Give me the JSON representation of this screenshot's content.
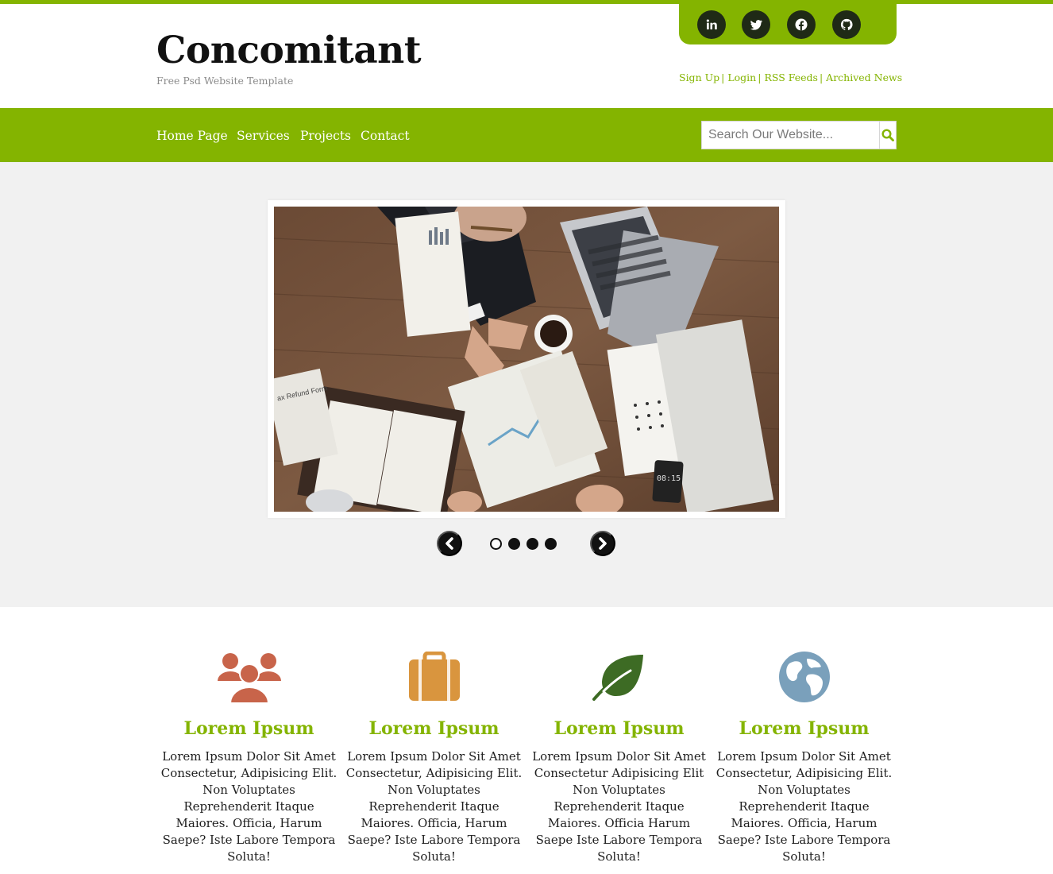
{
  "brand": {
    "logo": "Concomitant",
    "tagline": "Free Psd Website Template",
    "accent_color": "#84b400"
  },
  "social": [
    {
      "icon": "linkedin-icon"
    },
    {
      "icon": "twitter-icon"
    },
    {
      "icon": "facebook-icon"
    },
    {
      "icon": "github-icon"
    }
  ],
  "top_links": {
    "sign_up": "Sign Up",
    "login": "Login",
    "rss": "RSS Feeds",
    "archived": "Archived News",
    "separator": "|"
  },
  "nav": {
    "items": [
      "Home Page",
      "Services",
      "Projects",
      "Contact"
    ]
  },
  "search": {
    "placeholder": "Search Our Website...",
    "icon": "search-icon"
  },
  "slider": {
    "prev_icon": "chevron-left-icon",
    "next_icon": "chevron-right-icon",
    "active_index": 0,
    "dot_count": 4
  },
  "features": [
    {
      "icon": "users-icon",
      "icon_color": "#c8644a",
      "title": "Lorem Ipsum",
      "text": "Lorem Ipsum Dolor Sit Amet Consectetur, Adipisicing Elit. Non Voluptates Reprehenderit Itaque Maiores. Officia, Harum Saepe? Iste Labore Tempora Soluta!"
    },
    {
      "icon": "briefcase-icon",
      "icon_color": "#d9953e",
      "title": "Lorem Ipsum",
      "text": "Lorem Ipsum Dolor Sit Amet Consectetur, Adipisicing Elit. Non Voluptates Reprehenderit Itaque Maiores. Officia, Harum Saepe? Iste Labore Tempora Soluta!"
    },
    {
      "icon": "leaf-icon",
      "icon_color": "#3d6b24",
      "title": "Lorem Ipsum",
      "text": "Lorem Ipsum Dolor Sit Amet Consectetur Adipisicing Elit Non Voluptates Reprehenderit Itaque Maiores. Officia Harum Saepe Iste Labore Tempora Soluta!"
    },
    {
      "icon": "globe-icon",
      "icon_color": "#7aa0bb",
      "title": "Lorem Ipsum",
      "text": "Lorem Ipsum Dolor Sit Amet Consectetur, Adipisicing Elit. Non Voluptates Reprehenderit Itaque Maiores. Officia, Harum Saepe? Iste Labore Tempora Soluta!"
    }
  ]
}
